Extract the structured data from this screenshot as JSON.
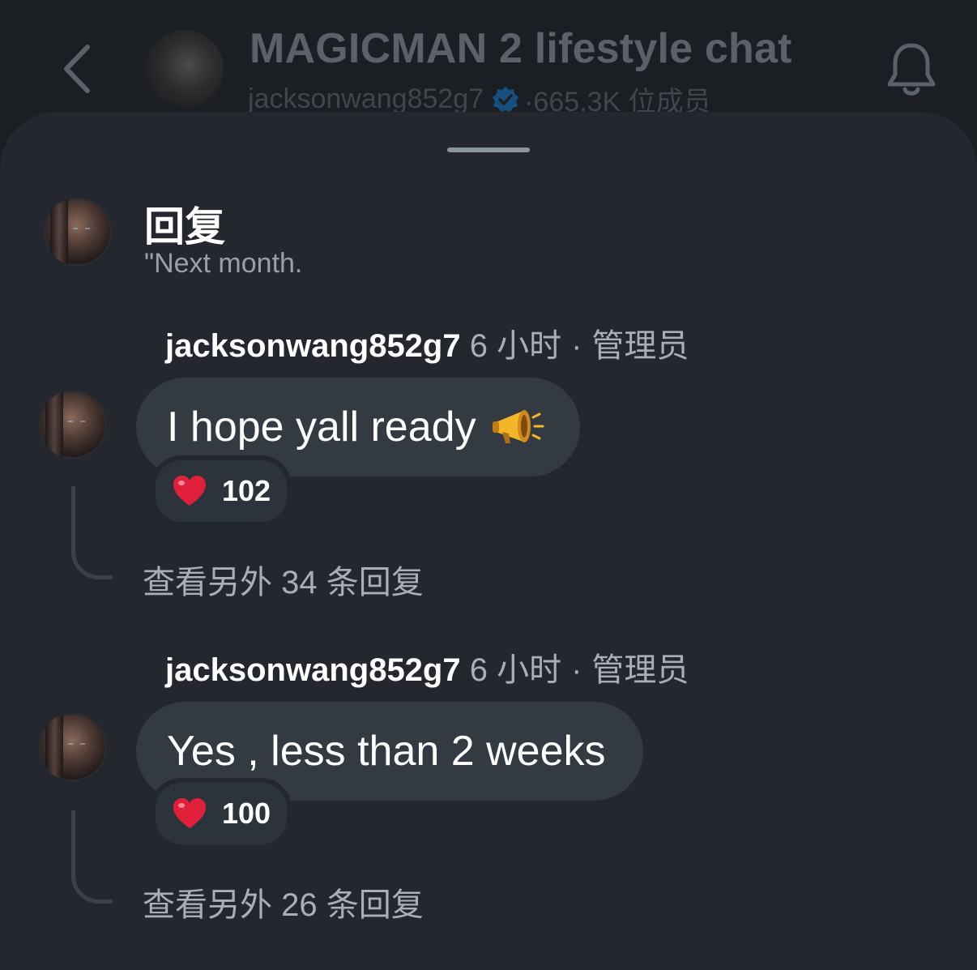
{
  "header": {
    "title": "MAGICMAN 2 lifestyle chat",
    "owner": "jacksonwang852g7",
    "members": "·665.3K 位成员",
    "back_icon": "chevron-left-icon",
    "bell_icon": "bell-icon"
  },
  "sheet": {
    "heading": "回复",
    "quote": "\"Next month."
  },
  "messages": [
    {
      "user": "jacksonwang852g7",
      "time": "6 小时",
      "separator": "·",
      "role": "管理员",
      "text": "I hope yall ready",
      "emoji": "megaphone-icon",
      "reaction_icon": "heart-icon",
      "reaction_count": "102",
      "more_replies": "查看另外 34 条回复"
    },
    {
      "user": "jacksonwang852g7",
      "time": "6 小时",
      "separator": "·",
      "role": "管理员",
      "text": "Yes , less than 2 weeks",
      "reaction_icon": "heart-icon",
      "reaction_count": "100",
      "more_replies": "查看另外 26 条回复"
    }
  ],
  "colors": {
    "background": "#1b1f24",
    "sheet": "#24282e",
    "bubble": "#333a42",
    "verified": "#1d9bf0",
    "heart": "#e0203a"
  }
}
